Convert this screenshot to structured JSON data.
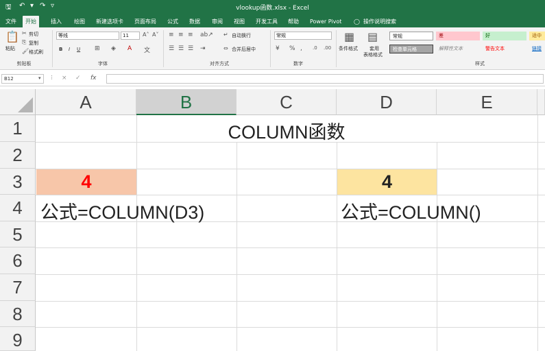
{
  "window": {
    "title": "vlookup函数.xlsx - Excel"
  },
  "quick_access": {
    "save_icon": "save-icon",
    "undo_icon": "undo-icon",
    "redo_icon": "redo-icon"
  },
  "tabs": [
    {
      "label": "文件"
    },
    {
      "label": "开始"
    },
    {
      "label": "插入"
    },
    {
      "label": "绘图"
    },
    {
      "label": "新建选项卡"
    },
    {
      "label": "页面布局"
    },
    {
      "label": "公式"
    },
    {
      "label": "数据"
    },
    {
      "label": "审阅"
    },
    {
      "label": "视图"
    },
    {
      "label": "开发工具"
    },
    {
      "label": "帮助"
    },
    {
      "label": "Power Pivot"
    },
    {
      "label": "操作说明搜索"
    }
  ],
  "ribbon": {
    "clipboard": {
      "paste": "粘贴",
      "cut": "剪切",
      "copy": "复制",
      "format_painter": "格式刷",
      "label": "剪贴板"
    },
    "font": {
      "name": "等线",
      "size": "11",
      "label": "字体",
      "bold": "B",
      "italic": "I",
      "underline": "U"
    },
    "alignment": {
      "wrap": "自动换行",
      "merge": "合并后居中",
      "label": "对齐方式"
    },
    "number": {
      "format": "常规",
      "label": "数字"
    },
    "styles": {
      "conditional": "条件格式",
      "table": "套用",
      "table2": "表格格式",
      "label": "样式",
      "cells": [
        {
          "text": "常规"
        },
        {
          "text": "差"
        },
        {
          "text": "好"
        },
        {
          "text": "适中"
        },
        {
          "text": "检查单元格"
        },
        {
          "text": "解释性文本"
        },
        {
          "text": "警告文本"
        },
        {
          "text": "链接"
        }
      ]
    }
  },
  "formula_bar": {
    "name_box": "B12",
    "cancel": "×",
    "enter": "✓",
    "fx": "fx",
    "formula": ""
  },
  "sheet": {
    "columns": [
      "A",
      "B",
      "C",
      "D",
      "E"
    ],
    "rows": [
      "1",
      "2",
      "3",
      "4",
      "5",
      "6",
      "7",
      "8",
      "9"
    ],
    "selected_column": "B",
    "cells": {
      "title": "COLUMN函数",
      "a3": "4",
      "a4": "公式=COLUMN(D3)",
      "d3": "4",
      "d4": "公式=COLUMN()"
    },
    "colors": {
      "a3_fill": "#f7c6a9",
      "a3_text": "#ff0000",
      "d3_fill": "#fde4a0",
      "d3_text": "#222222",
      "header_accent": "#217346"
    }
  }
}
